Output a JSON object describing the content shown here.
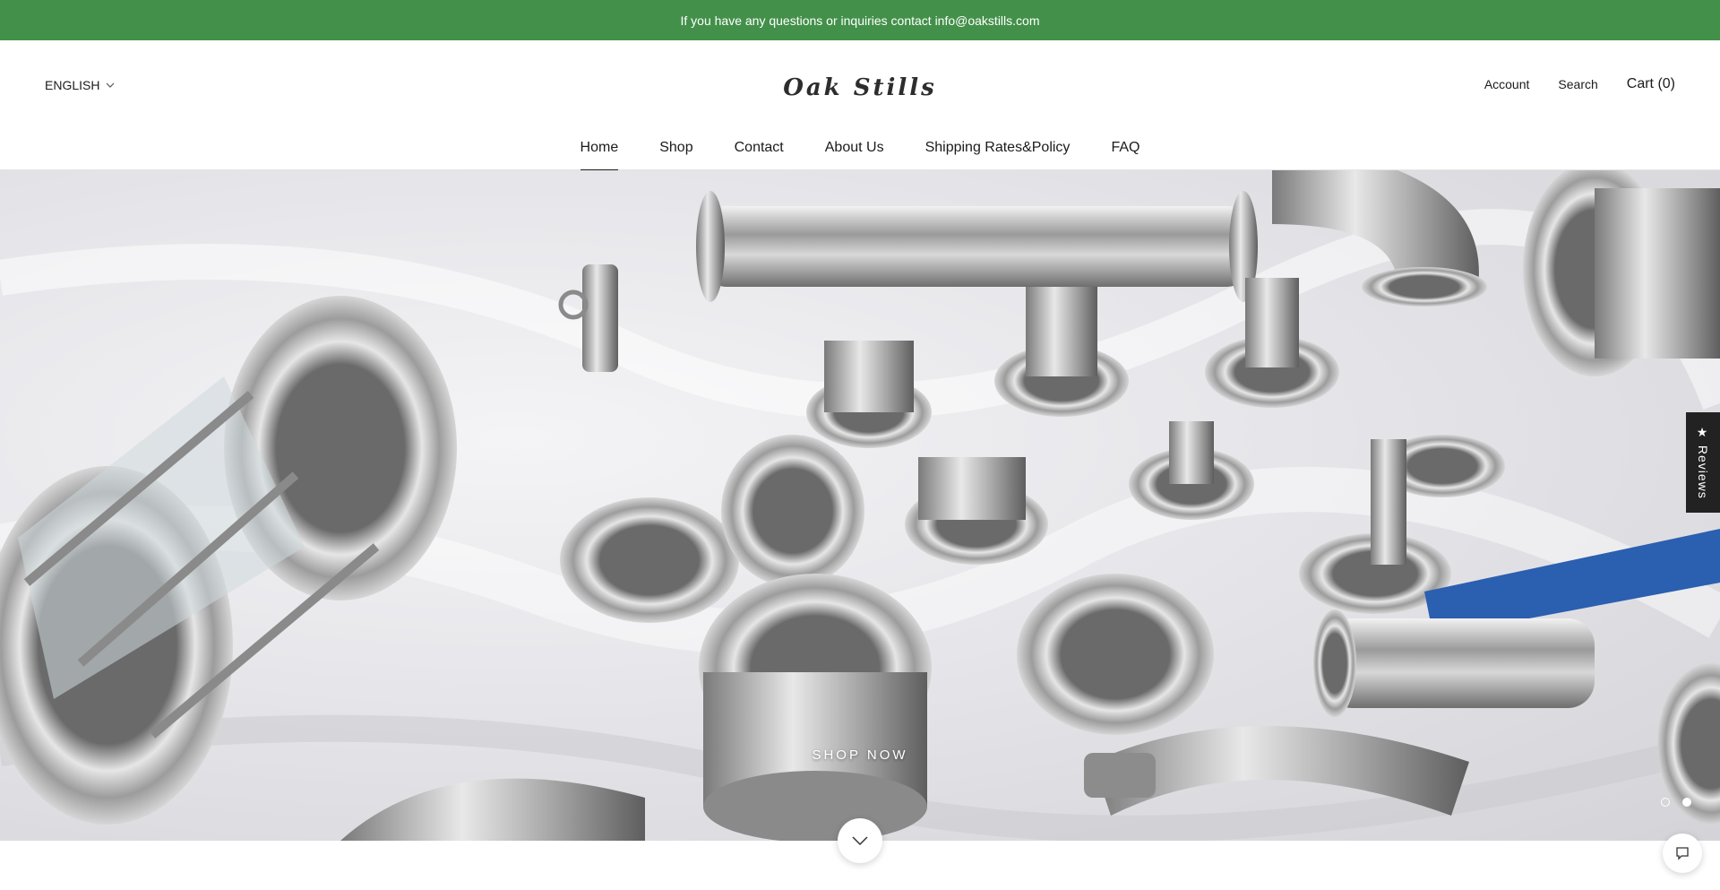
{
  "announcement": {
    "text": "If you have any questions or inquiries contact info@oakstills.com"
  },
  "header": {
    "language": "ENGLISH",
    "logo": "Oak Stills",
    "account": "Account",
    "search": "Search",
    "cart": "Cart (0)"
  },
  "nav": {
    "items": [
      {
        "label": "Home",
        "active": true
      },
      {
        "label": "Shop"
      },
      {
        "label": "Contact"
      },
      {
        "label": "About Us"
      },
      {
        "label": "Shipping Rates&Policy"
      },
      {
        "label": "FAQ"
      }
    ]
  },
  "hero": {
    "cta": "SHOP NOW",
    "slides_total": 2,
    "active_slide": 2
  },
  "reviews_tab": {
    "label": "★ Reviews"
  },
  "icons": {
    "language": "chevron-down-icon",
    "scroll": "chevron-down-icon",
    "chat": "chat-icon"
  }
}
